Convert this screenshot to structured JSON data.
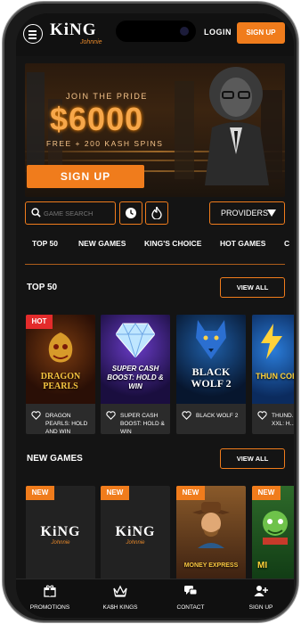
{
  "header": {
    "logo_text": "KiNG",
    "logo_sub": "Johnnie",
    "login_label": "LOGIN",
    "signup_label": "SIGN UP"
  },
  "banner": {
    "tagline": "JOIN THE PRIDE",
    "prize": "$6000",
    "spins": "FREE + 200 KASH SPINS",
    "signup_label": "SIGN UP"
  },
  "filters": {
    "search_placeholder": "GAME SEARCH",
    "providers_label": "PROVIDERS"
  },
  "tabs": [
    "TOP 50",
    "NEW GAMES",
    "KING'S CHOICE",
    "HOT GAMES",
    "C"
  ],
  "top50": {
    "title": "TOP 50",
    "view_all": "VIEW ALL",
    "games": [
      {
        "name": "DRAGON PEARLS: HOLD AND WIN",
        "thumb_title": "DRAGON PEARLS",
        "badge": "HOT"
      },
      {
        "name": "SUPER CASH BOOST: HOLD & WIN",
        "thumb_title": "SUPER CASH BOOST: HOLD & WIN",
        "badge": ""
      },
      {
        "name": "BLACK WOLF 2",
        "thumb_title": "BLACK WOLF 2",
        "badge": ""
      },
      {
        "name": "THUND... XXL: H...",
        "thumb_title": "THUN COIN",
        "badge": ""
      }
    ]
  },
  "new_games": {
    "title": "NEW GAMES",
    "view_all": "VIEW ALL",
    "badge": "NEW",
    "games": [
      {
        "thumb_title": "KiNG",
        "thumb_sub": "Johnnie"
      },
      {
        "thumb_title": "KiNG",
        "thumb_sub": "Johnnie"
      },
      {
        "thumb_title": "MONEY EXPRESS"
      },
      {
        "thumb_title": "MI"
      }
    ]
  },
  "bottom_nav": [
    {
      "label": "PROMOTIONS",
      "icon": "gift-icon"
    },
    {
      "label": "KA$H KINGS",
      "icon": "crown-icon"
    },
    {
      "label": "CONTACT",
      "icon": "chat-icon"
    },
    {
      "label": "SIGN UP",
      "icon": "add-user-icon"
    }
  ],
  "colors": {
    "accent": "#f07c1c",
    "background": "#141414",
    "hot": "#e32b2b"
  }
}
